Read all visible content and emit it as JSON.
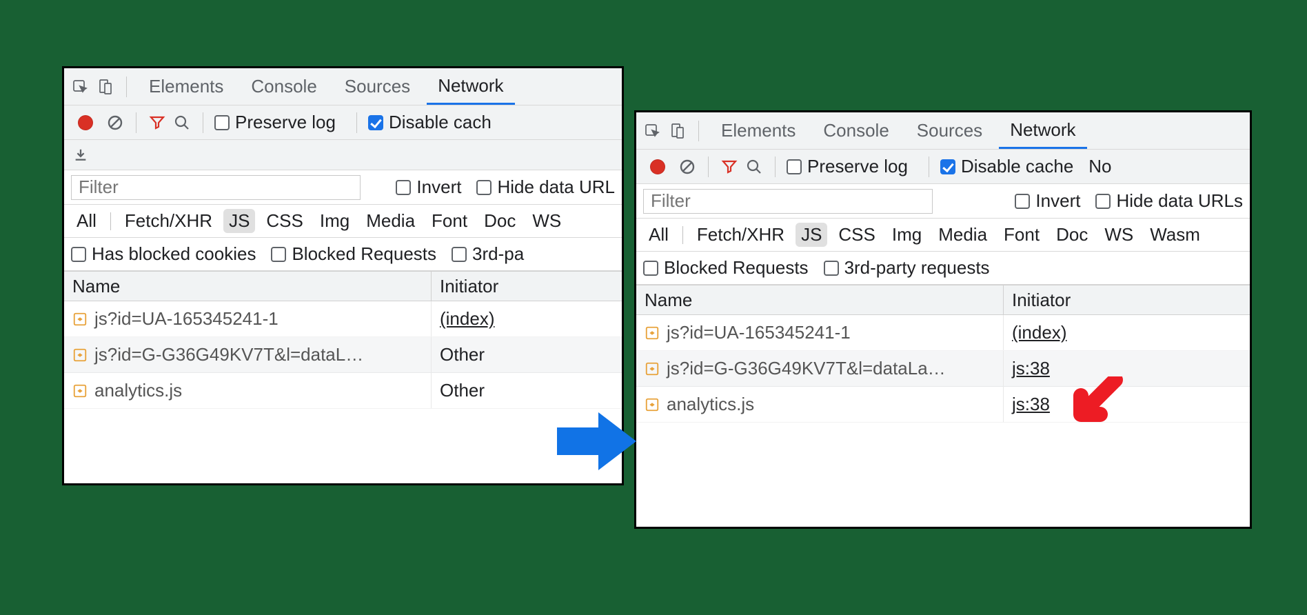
{
  "tabs": {
    "elements": "Elements",
    "console": "Console",
    "sources": "Sources",
    "network": "Network"
  },
  "options": {
    "preserve_log": "Preserve log",
    "disable_cache": "Disable cache",
    "disable_cache_cut": "Disable cach",
    "no_cut": "No"
  },
  "filter": {
    "placeholder": "Filter",
    "invert": "Invert",
    "hide_urls": "Hide data URLs",
    "hide_urls_cut": "Hide data URL"
  },
  "types": [
    "All",
    "Fetch/XHR",
    "JS",
    "CSS",
    "Img",
    "Media",
    "Font",
    "Doc",
    "WS",
    "Wasm"
  ],
  "type_selected": "JS",
  "checks": {
    "has_blocked": "Has blocked cookies",
    "blocked_requests": "Blocked Requests",
    "third_party": "3rd-party requests",
    "third_party_cut": "3rd-pa"
  },
  "table": {
    "headers": {
      "name": "Name",
      "initiator": "Initiator"
    }
  },
  "left_rows": [
    {
      "name": "js?id=UA-165345241-1",
      "initiator": "(index)",
      "link": true
    },
    {
      "name": "js?id=G-G36G49KV7T&l=dataL…",
      "initiator": "Other",
      "link": false
    },
    {
      "name": "analytics.js",
      "initiator": "Other",
      "link": false
    }
  ],
  "right_rows": [
    {
      "name": "js?id=UA-165345241-1",
      "initiator": "(index)",
      "link": true
    },
    {
      "name": "js?id=G-G36G49KV7T&l=dataLa…",
      "initiator": "js:38",
      "link": true
    },
    {
      "name": "analytics.js",
      "initiator": "js:38",
      "link": true
    }
  ]
}
